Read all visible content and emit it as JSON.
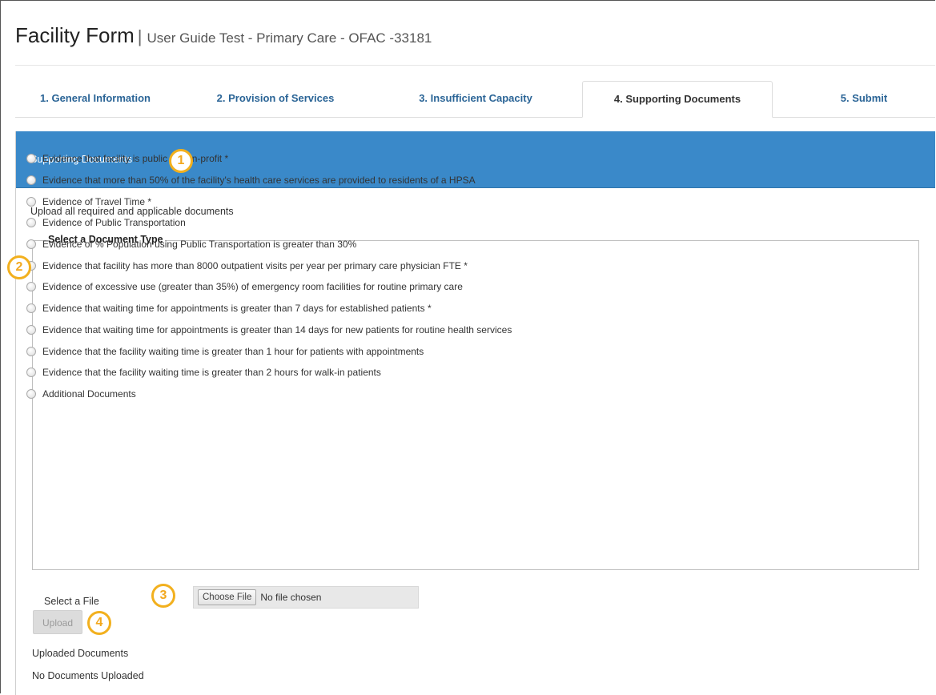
{
  "header": {
    "title": "Facility Form",
    "separator": "|",
    "subtitle": "User Guide Test - Primary Care - OFAC -33181"
  },
  "tabs": [
    {
      "label": "1. General Information",
      "active": false
    },
    {
      "label": "2. Provision of Services",
      "active": false
    },
    {
      "label": "3. Insufficient Capacity",
      "active": false
    },
    {
      "label": "4. Supporting Documents",
      "active": true
    },
    {
      "label": "5. Submit",
      "active": false
    }
  ],
  "panel": {
    "title": "Supporting Documents",
    "intro": "Upload all required and applicable documents"
  },
  "document_type": {
    "legend": "Select a Document Type",
    "options": [
      "Evidence that facility is public or non-profit *",
      "Evidence that more than 50% of the facility's health care services are provided to residents of a HPSA",
      "Evidence of Travel Time *",
      "Evidence of Public Transportation",
      "Evidence of % Population using Public Transportation is greater than 30%",
      "Evidence that facility has more than 8000 outpatient visits per year per primary care physician FTE *",
      "Evidence of excessive use (greater than 35%) of emergency room facilities for routine primary care",
      "Evidence that waiting time for appointments is greater than 7 days for established patients *",
      "Evidence that waiting time for appointments is greater than 14 days for new patients for routine health services",
      "Evidence that the facility waiting time is greater than 1 hour for patients with appointments",
      "Evidence that the facility waiting time is greater than 2 hours for walk-in patients",
      "Additional Documents"
    ]
  },
  "file": {
    "label": "Select a File",
    "choose_button": "Choose File",
    "status": "No file chosen"
  },
  "upload": {
    "button": "Upload",
    "uploaded_title": "Uploaded Documents",
    "empty_text": "No Documents Uploaded"
  },
  "callouts": [
    "1",
    "2",
    "3",
    "4"
  ],
  "colors": {
    "header_blue": "#3a89c9",
    "tab_link": "#2a6496",
    "callout": "#f2b01e"
  }
}
